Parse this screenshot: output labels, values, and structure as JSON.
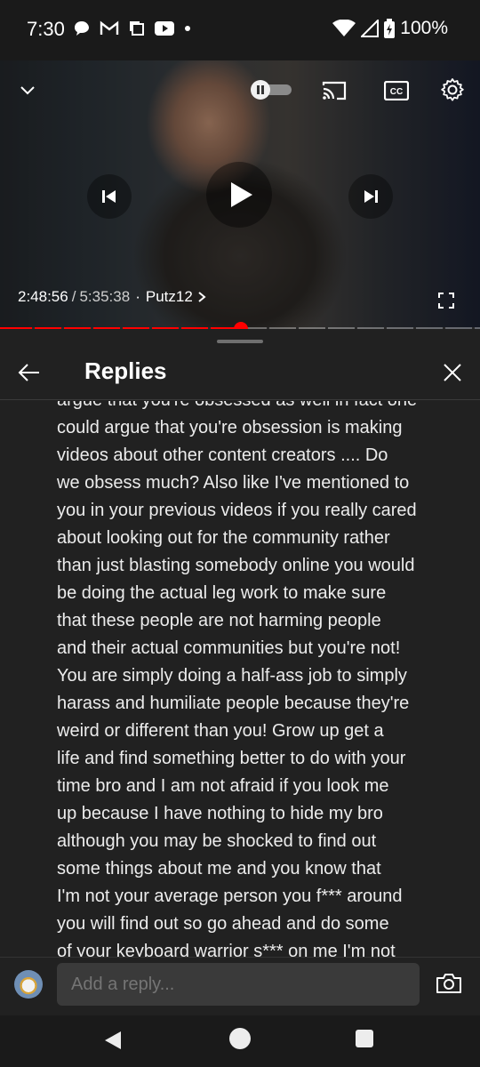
{
  "status_bar": {
    "time": "7:30",
    "battery": "100%",
    "left_icons": [
      "chat-bubble-icon",
      "gmail-icon",
      "copy-icon",
      "youtube-icon",
      "dot-icon"
    ],
    "right_icons": [
      "wifi-icon",
      "signal-icon",
      "battery-icon"
    ]
  },
  "player": {
    "current_time": "2:48:56",
    "separator": "/",
    "duration": "5:35:38",
    "dot": "·",
    "chapter": "Putz12",
    "progress_fraction": 0.502,
    "accent": "#ff0000"
  },
  "panel": {
    "title": "Replies",
    "comment_lines": [
      "argue that you're obsessed as well in fact one",
      "could argue that you're obsession is making",
      "videos about other content creators .... Do",
      "we obsess much? Also like I've mentioned to",
      "you in your previous videos if you really cared",
      "about looking out for the community rather",
      "than just blasting somebody online you would",
      "be doing the actual leg work to make sure",
      "that these people are not harming people",
      "and their actual communities but you're not!",
      "You are simply doing a half-ass job to simply",
      "harass and humiliate people because they're",
      "weird or different than you! Grow up get a",
      "life and find something better to do with your",
      "time bro and I am not afraid if you look me",
      "up because I have nothing to hide my bro",
      "although you may be shocked to find out",
      "some things about me and you know that",
      "I'm not your average person you f*** around",
      "you will find out so go ahead and do some",
      "of your keyboard warrior s*** on me I'm not"
    ]
  },
  "reply_bar": {
    "placeholder": "Add a reply..."
  }
}
